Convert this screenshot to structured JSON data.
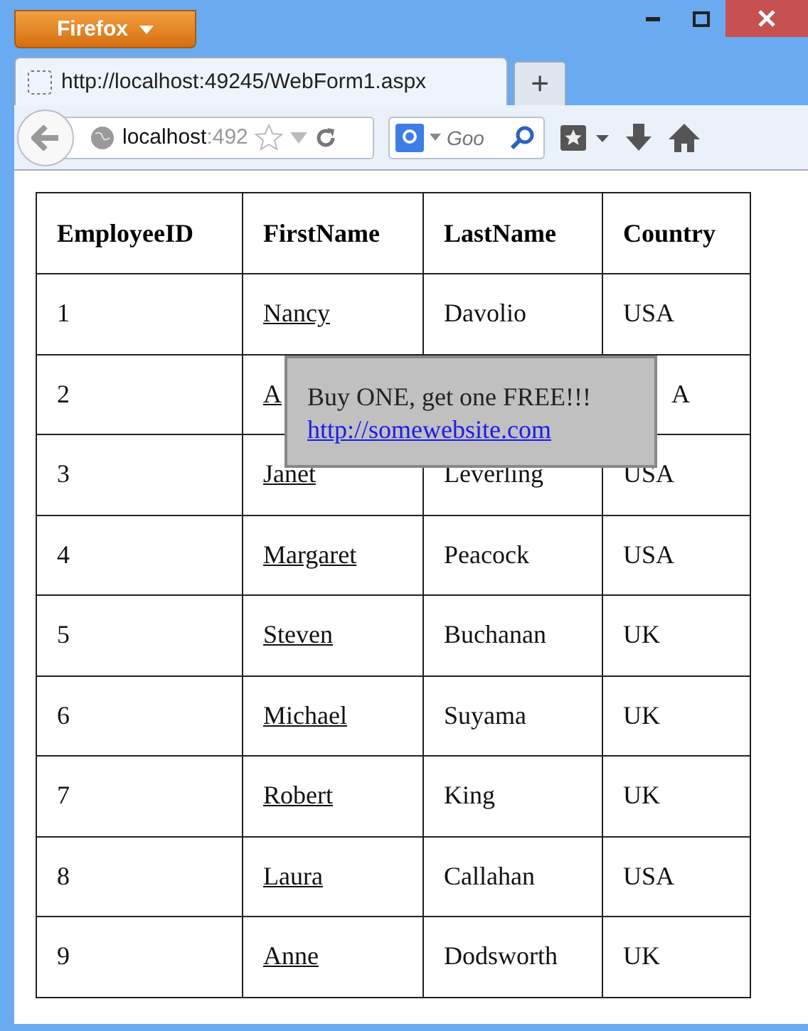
{
  "browser": {
    "menu_button": "Firefox",
    "tab_title": "http://localhost:49245/WebForm1.aspx",
    "new_tab": "+",
    "address_host": "localhost",
    "address_rest": ":492",
    "search_placeholder": "Goo"
  },
  "table": {
    "columns": [
      "EmployeeID",
      "FirstName",
      "LastName",
      "Country"
    ],
    "rows": [
      {
        "id": "1",
        "first": "Nancy",
        "last": "Davolio",
        "country": "USA"
      },
      {
        "id": "2",
        "first": "A",
        "last": "",
        "country": "A",
        "covered": true
      },
      {
        "id": "3",
        "first": "Janet",
        "last": "Leverling",
        "country": "USA"
      },
      {
        "id": "4",
        "first": "Margaret",
        "last": "Peacock",
        "country": "USA"
      },
      {
        "id": "5",
        "first": "Steven",
        "last": "Buchanan",
        "country": "UK"
      },
      {
        "id": "6",
        "first": "Michael",
        "last": "Suyama",
        "country": "UK"
      },
      {
        "id": "7",
        "first": "Robert",
        "last": "King",
        "country": "UK"
      },
      {
        "id": "8",
        "first": "Laura",
        "last": "Callahan",
        "country": "USA"
      },
      {
        "id": "9",
        "first": "Anne",
        "last": "Dodsworth",
        "country": "UK"
      }
    ]
  },
  "popup": {
    "text": "Buy ONE, get one FREE!!!",
    "link": "http://somewebsite.com"
  }
}
